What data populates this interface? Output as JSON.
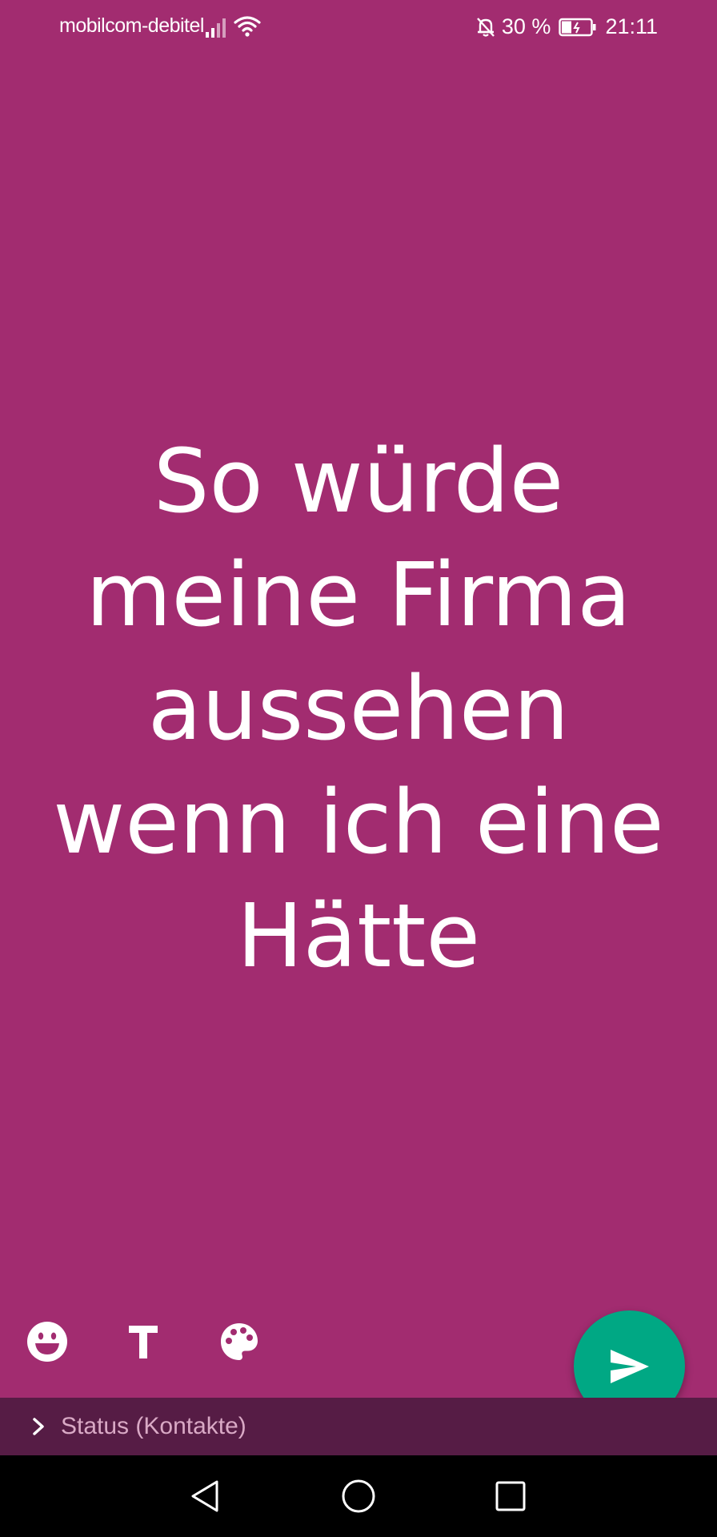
{
  "status_bar": {
    "carrier": "mobilcom-debitel",
    "battery": "30 %",
    "time": "21:11",
    "icons": [
      "signal-icon",
      "wifi-icon",
      "bell-off-icon",
      "battery-icon"
    ]
  },
  "status_text": {
    "lines": [
      "So würde",
      "meine Firma",
      "aussehen",
      "wenn ich eine",
      "Hätte"
    ]
  },
  "tools": {
    "icons": [
      "emoji-icon",
      "text-style-icon",
      "palette-icon"
    ]
  },
  "send": {
    "icon": "send-icon"
  },
  "audience": {
    "label": "Status (Kontakte)",
    "icon": "chevron-right-icon"
  },
  "navigation": {
    "icons": [
      "back-icon",
      "home-icon",
      "recents-icon"
    ]
  },
  "colors": {
    "background": "#a22c70",
    "send_button": "#00a884",
    "audience_bar": "#561c45",
    "nav_bar": "#000000"
  }
}
